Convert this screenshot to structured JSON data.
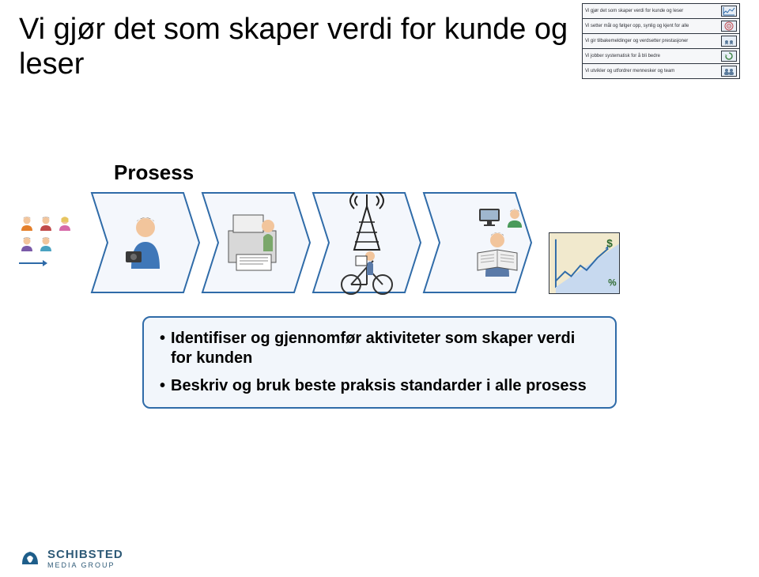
{
  "title": "Vi gjør det som skaper verdi for kunde og leser",
  "sidebar": {
    "items": [
      {
        "label": "Vi gjør det som skaper verdi for kunde og leser",
        "icon": "chart-icon"
      },
      {
        "label": "Vi setter mål og følger opp, synlig og kjent for alle",
        "icon": "target-icon"
      },
      {
        "label": "Vi gir tilbakemeldinger og verdsetter prestasjoner",
        "icon": "feedback-icon"
      },
      {
        "label": "Vi jobber systematisk for å bli bedre",
        "icon": "cycle-icon"
      },
      {
        "label": "Vi utvikler og utfordrer mennesker og team",
        "icon": "team-icon"
      }
    ]
  },
  "process": {
    "title": "Prosess"
  },
  "chart_data": {
    "type": "line",
    "title": "",
    "annotations": [
      "$",
      "%"
    ],
    "x": [
      0,
      1,
      2,
      3,
      4,
      5,
      6
    ],
    "values": [
      10,
      22,
      16,
      30,
      24,
      40,
      55
    ],
    "ylim": [
      0,
      60
    ]
  },
  "bullets": {
    "items": [
      "Identifiser og gjennomfør aktiviteter som skaper verdi for kunden",
      "Beskriv og bruk beste praksis standarder i alle prosess"
    ]
  },
  "footer": {
    "brand": "SCHIBSTED",
    "brand_sub": "MEDIA GROUP"
  },
  "icons": {
    "avatar1": "avatar-orange",
    "avatar2": "avatar-red",
    "avatar3": "avatar-pink",
    "avatar4": "avatar-purple",
    "avatar5": "avatar-cyan",
    "photographer": "photographer-icon",
    "printer": "printer-icon",
    "antenna": "antenna-icon",
    "delivery": "bicycle-delivery-icon",
    "reader_person": "reader-icon",
    "reader_avatar": "avatar-green",
    "reader_monitor": "monitor-icon"
  }
}
